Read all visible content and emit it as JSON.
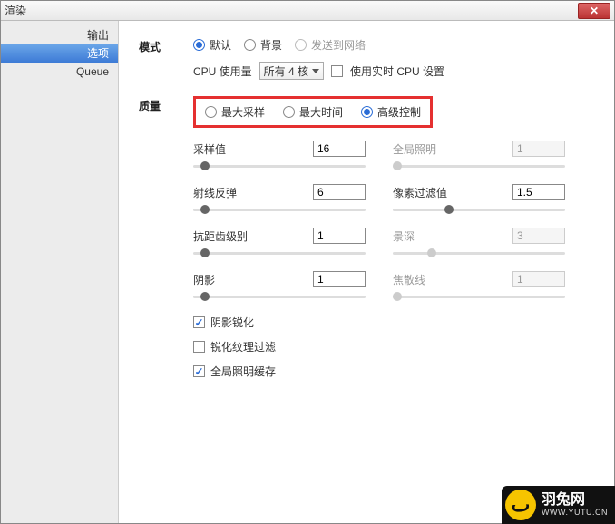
{
  "window": {
    "title": "渲染"
  },
  "sidebar": {
    "items": [
      {
        "label": "输出",
        "selected": false
      },
      {
        "label": "选项",
        "selected": true
      },
      {
        "label": "Queue",
        "selected": false
      }
    ]
  },
  "mode": {
    "label": "模式",
    "options": [
      {
        "label": "默认",
        "state": "on"
      },
      {
        "label": "背景",
        "state": "off"
      },
      {
        "label": "发送到网络",
        "state": "disabled"
      }
    ],
    "cpu_label": "CPU 使用量",
    "cpu_select": "所有 4 核",
    "realtime_checkbox": {
      "label": "使用实时 CPU 设置",
      "checked": false
    }
  },
  "quality": {
    "label": "质量",
    "options": [
      {
        "label": "最大采样",
        "state": "off"
      },
      {
        "label": "最大时间",
        "state": "off"
      },
      {
        "label": "高级控制",
        "state": "on"
      }
    ],
    "params": [
      {
        "label": "采样值",
        "value": "16",
        "disabled": false,
        "thumb_pct": 4
      },
      {
        "label": "全局照明",
        "value": "1",
        "disabled": true,
        "thumb_pct": 0
      },
      {
        "label": "射线反弹",
        "value": "6",
        "disabled": false,
        "thumb_pct": 4
      },
      {
        "label": "像素过滤值",
        "value": "1.5",
        "disabled": false,
        "thumb_pct": 30
      },
      {
        "label": "抗距齿级别",
        "value": "1",
        "disabled": false,
        "thumb_pct": 4
      },
      {
        "label": "景深",
        "value": "3",
        "disabled": true,
        "thumb_pct": 20
      },
      {
        "label": "阴影",
        "value": "1",
        "disabled": false,
        "thumb_pct": 4
      },
      {
        "label": "焦散线",
        "value": "1",
        "disabled": true,
        "thumb_pct": 0
      }
    ],
    "checks": [
      {
        "label": "阴影锐化",
        "checked": true
      },
      {
        "label": "锐化纹理过滤",
        "checked": false
      },
      {
        "label": "全局照明缓存",
        "checked": true
      }
    ]
  },
  "watermark": {
    "brand_cn": "羽兔网",
    "url": "WWW.YUTU.CN"
  },
  "colors": {
    "accent": "#2a6cd6",
    "highlight_border": "#e53030"
  }
}
